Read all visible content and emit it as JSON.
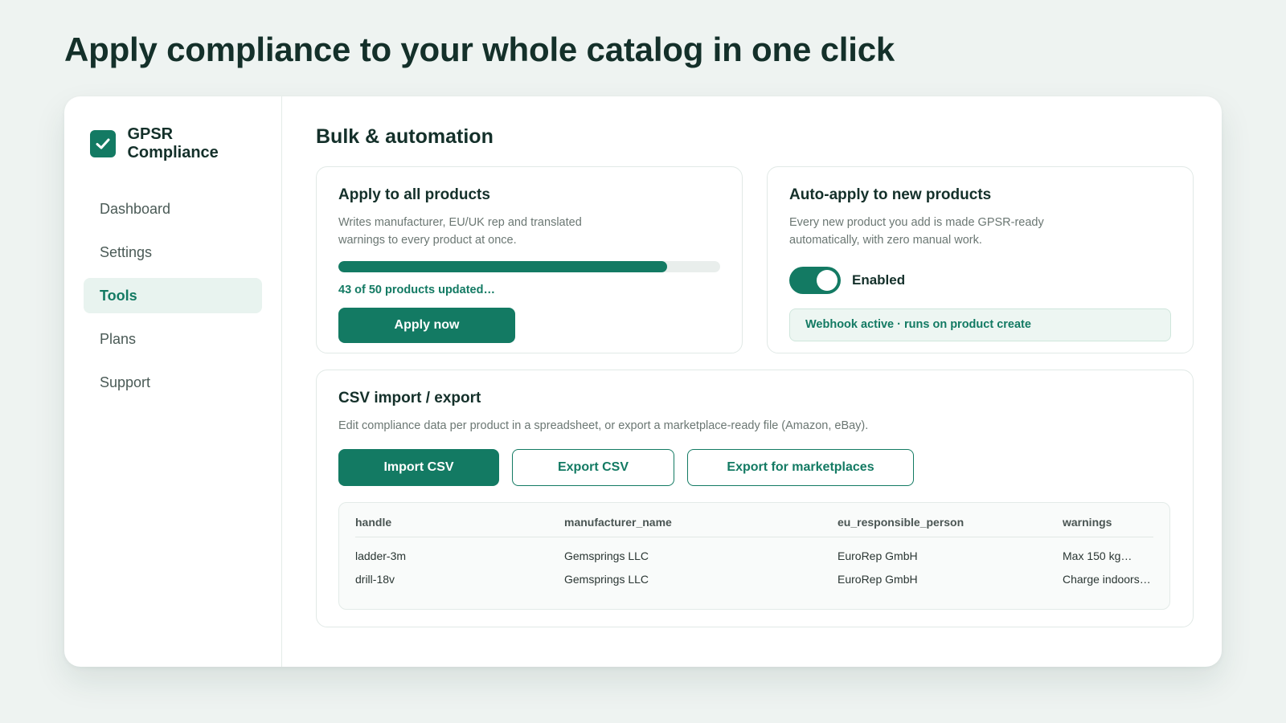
{
  "headline": "Apply compliance to your whole catalog in one click",
  "brand": {
    "name": "GPSR Compliance",
    "icon": "check-icon",
    "accent": "#137a63"
  },
  "sidebar": {
    "items": [
      {
        "label": "Dashboard",
        "active": false
      },
      {
        "label": "Settings",
        "active": false
      },
      {
        "label": "Tools",
        "active": true
      },
      {
        "label": "Plans",
        "active": false
      },
      {
        "label": "Support",
        "active": false
      }
    ]
  },
  "main": {
    "title": "Bulk & automation",
    "apply_card": {
      "title": "Apply to all products",
      "description": "Writes manufacturer, EU/UK rep and translated warnings to every product at once.",
      "progress_fraction": 0.86,
      "progress_text": "43 of 50 products updated…",
      "button_label": "Apply now"
    },
    "auto_card": {
      "title": "Auto-apply to new products",
      "description": "Every new product you add is made GPSR-ready automatically, with zero manual work.",
      "toggle_on": true,
      "toggle_label": "Enabled",
      "webhook_status": "Webhook active · runs on product create"
    },
    "csv_card": {
      "title": "CSV import / export",
      "description": "Edit compliance data per product in a spreadsheet, or export a marketplace-ready file (Amazon, eBay).",
      "buttons": {
        "import": "Import CSV",
        "export": "Export CSV",
        "marketplaces": "Export for marketplaces"
      },
      "table": {
        "columns": [
          "handle",
          "manufacturer_name",
          "eu_responsible_person",
          "warnings"
        ],
        "rows": [
          [
            "ladder-3m",
            "Gemsprings LLC",
            "EuroRep GmbH",
            "Max 150 kg…"
          ],
          [
            "drill-18v",
            "Gemsprings LLC",
            "EuroRep GmbH",
            "Charge indoors…"
          ]
        ]
      }
    }
  }
}
